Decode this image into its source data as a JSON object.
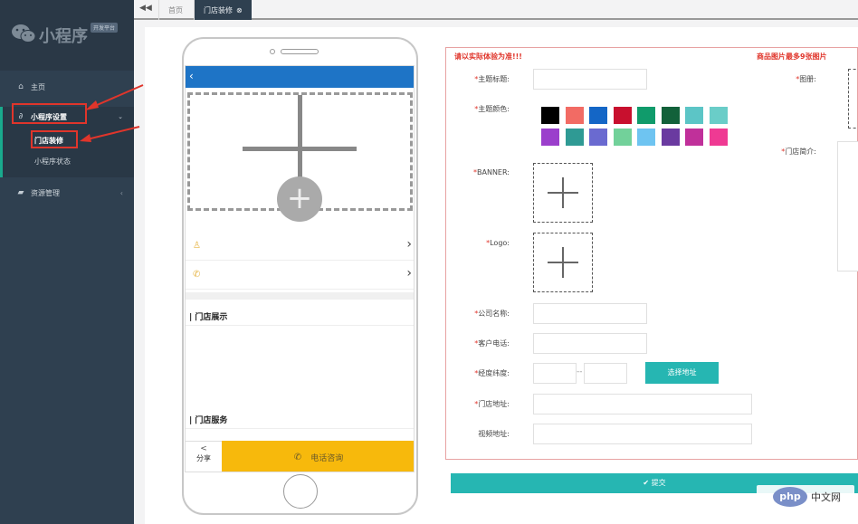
{
  "sidebar": {
    "brand_title": "小程序",
    "brand_tag": "开发平台",
    "home_label": "主页",
    "miniapp_label": "小程序设置",
    "sub_items": [
      "门店装修",
      "小程序状态"
    ],
    "resource_label": "资源管理"
  },
  "tabs": {
    "home": "首页",
    "active": "门店装修"
  },
  "phone": {
    "section_display": "| 门店展示",
    "section_service": "| 门店服务",
    "share_label": "分享",
    "call_label": "电话咨询"
  },
  "form": {
    "warn_left": "请以实际体验为准!!!",
    "warn_right": "商品图片最多9张图片",
    "labels": {
      "theme_title": "主题标题:",
      "theme_color": "主题颜色:",
      "banner": "BANNER:",
      "logo": "Logo:",
      "company": "公司名称:",
      "phone": "客户电话:",
      "latlng": "经度纬度:",
      "address": "门店地址:",
      "video": "视频地址:",
      "album": "图册:",
      "intro": "门店简介:"
    },
    "latlng_sep": "--",
    "select_address": "选择地址",
    "submit": "✔ 提交"
  },
  "colors": {
    "swatches_row1": [
      "#000000",
      "#f26b64",
      "#1466c6",
      "#c8102e",
      "#109b6b",
      "#12613a",
      "#5cc5c6",
      "#6acdc8"
    ],
    "swatches_row2": [
      "#9b3fcc",
      "#2f9a94",
      "#6a6ad0",
      "#72d19a",
      "#6ec4f1",
      "#6a3aa0",
      "#c0309a",
      "#ef3a93"
    ]
  },
  "watermark": {
    "oval": "php",
    "text": "中文网"
  }
}
